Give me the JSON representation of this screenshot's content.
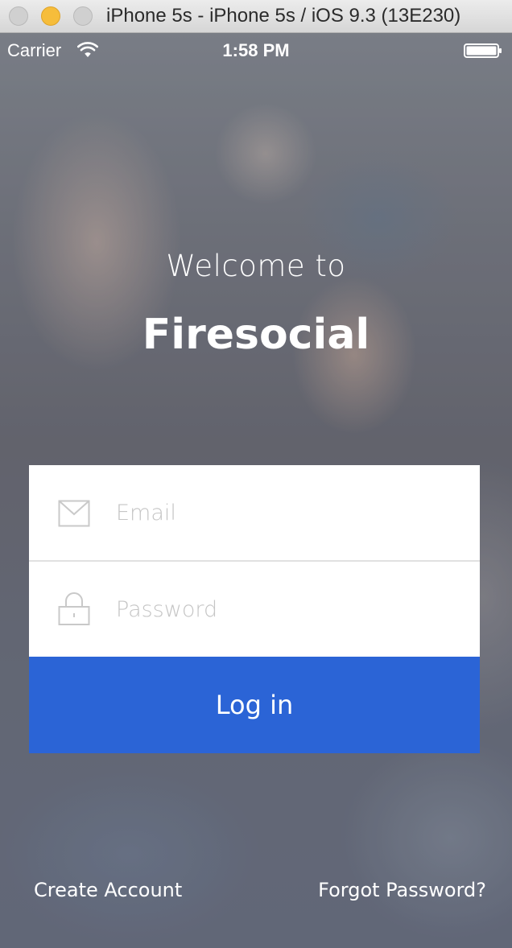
{
  "window": {
    "title": "iPhone 5s - iPhone 5s / iOS 9.3 (13E230)"
  },
  "status_bar": {
    "carrier": "Carrier",
    "time": "1:58 PM",
    "icons": [
      "wifi-icon",
      "battery-icon"
    ]
  },
  "welcome": {
    "greeting": "Welcome to",
    "app_name": "Firesocial"
  },
  "login_form": {
    "email": {
      "icon": "envelope-icon",
      "placeholder": "Email",
      "value": ""
    },
    "password": {
      "icon": "lock-icon",
      "placeholder": "Password",
      "value": ""
    },
    "login_button_label": "Log in"
  },
  "footer": {
    "create_account_label": "Create Account",
    "forgot_password_label": "Forgot Password?"
  },
  "colors": {
    "primary_button": "#2b64d6",
    "field_background": "#ffffff",
    "placeholder": "#c5c5c5",
    "text_on_image": "#ffffff"
  }
}
